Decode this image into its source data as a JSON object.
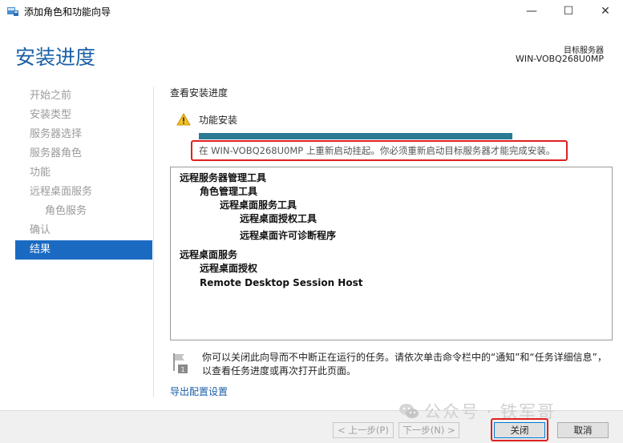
{
  "window": {
    "title": "添加角色和功能向导",
    "minimize": "—",
    "maximize": "☐",
    "close": "✕"
  },
  "header": {
    "page_title": "安装进度",
    "target_label": "目标服务器",
    "target_name": "WIN-VOBQ268U0MP"
  },
  "nav": {
    "items": [
      {
        "label": "开始之前"
      },
      {
        "label": "安装类型"
      },
      {
        "label": "服务器选择"
      },
      {
        "label": "服务器角色"
      },
      {
        "label": "功能"
      },
      {
        "label": "远程桌面服务"
      },
      {
        "label": "角色服务"
      },
      {
        "label": "确认"
      },
      {
        "label": "结果"
      }
    ]
  },
  "main": {
    "section_title": "查看安装进度",
    "feature_label": "功能安装",
    "progress": 1.0,
    "status_message": "在 WIN-VOBQ268U0MP 上重新启动挂起。你必须重新启动目标服务器才能完成安装。",
    "results": [
      {
        "text": "远程服务器管理工具"
      },
      {
        "text": "角色管理工具"
      },
      {
        "text": "远程桌面服务工具"
      },
      {
        "text": "远程桌面授权工具"
      },
      {
        "text": "远程桌面许可诊断程序"
      },
      {
        "text": "远程桌面服务"
      },
      {
        "text": "远程桌面授权"
      },
      {
        "text": "Remote Desktop Session Host"
      }
    ],
    "notice": "你可以关闭此向导而不中断正在运行的任务。请依次单击命令栏中的“通知”和“任务详细信息”，以查看任务进度或再次打开此页面。",
    "export_link": "导出配置设置"
  },
  "footer": {
    "prev": "< 上一步(P)",
    "next": "下一步(N) >",
    "close": "关闭",
    "cancel": "取消"
  },
  "watermark": "公众号 · 铁军哥",
  "colors": {
    "accent": "#1a5fa8",
    "nav_active": "#1b6ac2",
    "progress": "#2a7a94",
    "highlight": "#e02020"
  }
}
